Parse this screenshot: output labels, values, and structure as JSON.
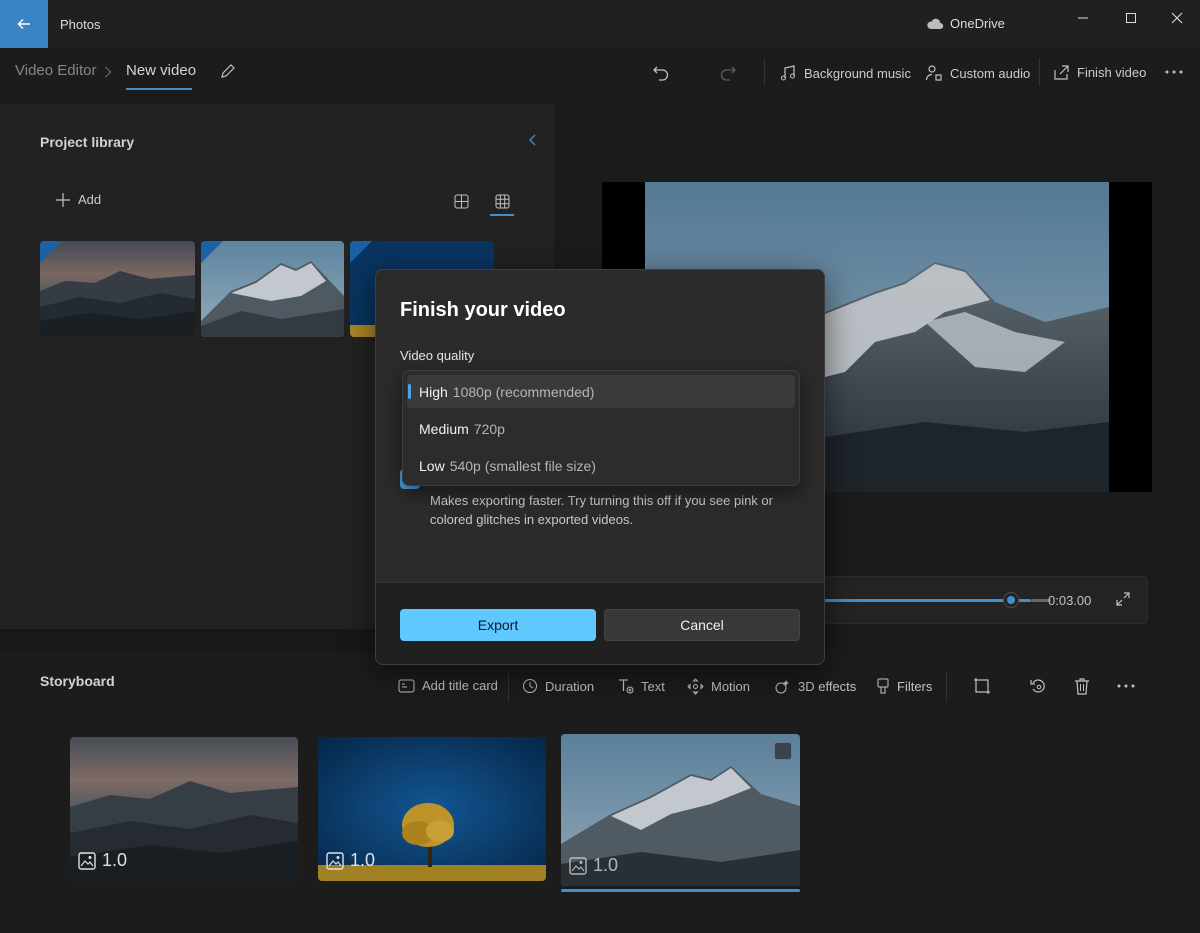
{
  "window": {
    "app_title": "Photos",
    "cloud_label": "OneDrive"
  },
  "breadcrumb": {
    "root": "Video Editor",
    "current": "New video"
  },
  "toolbar": {
    "background_music": "Background music",
    "custom_audio": "Custom audio",
    "finish_video": "Finish video"
  },
  "library": {
    "title": "Project library",
    "add_label": "Add"
  },
  "player": {
    "time": "0:03.00",
    "progress": 0.9
  },
  "storyboard": {
    "title": "Storyboard",
    "tools": {
      "add_title_card": "Add title card",
      "duration": "Duration",
      "text": "Text",
      "motion": "Motion",
      "effects_3d": "3D effects",
      "filters": "Filters"
    },
    "clips": [
      {
        "duration": "1.0"
      },
      {
        "duration": "1.0"
      },
      {
        "duration": "1.0",
        "selected": true
      }
    ]
  },
  "dialog": {
    "title": "Finish your video",
    "quality_label": "Video quality",
    "options": [
      {
        "name": "High",
        "detail": "1080p (recommended)",
        "selected": true
      },
      {
        "name": "Medium",
        "detail": "720p"
      },
      {
        "name": "Low",
        "detail": "540p (smallest file size)"
      }
    ],
    "hw_description": "Makes exporting faster. Try turning this off if you see pink or colored glitches in exported videos.",
    "export_label": "Export",
    "cancel_label": "Cancel"
  },
  "colors": {
    "accent": "#4aa3e8",
    "export_button": "#5ec8ff",
    "back_button": "#3b84c4"
  }
}
